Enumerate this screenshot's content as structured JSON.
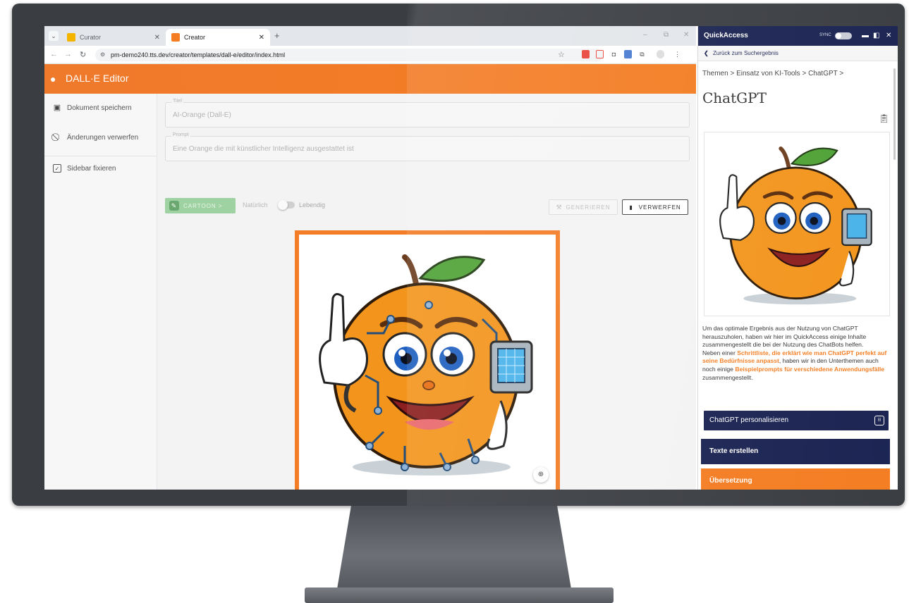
{
  "colors": {
    "accent_orange": "#f47d22",
    "navy": "#1b2452",
    "bezel": "#3a3d42",
    "cartoon_green": "#9fd2a3"
  },
  "browser": {
    "tabs": [
      {
        "label": "Curator",
        "icon": "curator-favicon"
      },
      {
        "label": "Creator",
        "icon": "creator-favicon"
      }
    ],
    "new_tab_label": "+",
    "url": "pm-demo240.tts.dev/creator/templates/dall-e/editor/index.html",
    "window_controls": [
      "–",
      "⧉",
      "✕"
    ]
  },
  "app": {
    "title": "DALL·E Editor",
    "sidebar": [
      {
        "label": "Dokument speichern",
        "icon": "save-icon"
      },
      {
        "label": "Änderungen verwerfen",
        "icon": "discard-icon"
      },
      {
        "label": "Sidebar fixieren",
        "icon": "checkbox-icon"
      }
    ],
    "title_field": {
      "label": "Titel",
      "value": "AI-Orange (Dall-E)"
    },
    "prompt_field": {
      "label": "Prompt",
      "value": "Eine Orange die mit künstlicher Intelligenz ausgestattet ist"
    },
    "style_button": "CARTOON >",
    "mode_left": "Natürlich",
    "mode_right": "Lebendig",
    "mode_value": "Natürlich",
    "generate_button": "GENERIEREN",
    "discard_button": "VERWERFEN"
  },
  "quickaccess": {
    "title": "QuickAccess",
    "sync_label": "SYNC",
    "back_link": "Zurück zum Suchergebnis",
    "breadcrumb": "Themen > Einsatz von KI-Tools > ChatGPT >",
    "heading": "ChatGPT",
    "intro_1": "Um das optimale Ergebnis aus der Nutzung von ChatGPT herauszuholen, haben wir hier im QuickAccess einige Inhalte zusammengestellt die bei der Nutzung des ChatBots helfen.",
    "intro_2_pre": "Neben einer ",
    "intro_2_link": "Schrittliste, die erklärt wie man ChatGPT perfekt auf seine Bedürfnisse anpasst",
    "intro_2_mid": ", haben wir in den Unterthemen auch noch einige ",
    "intro_2_link2": "Beispielprompts für verschiedene Anwendungsfälle",
    "intro_2_post": " zusammengestellt.",
    "items": [
      {
        "label": "ChatGPT personalisieren"
      },
      {
        "label": "Texte erstellen"
      },
      {
        "label": "Übersetzung"
      }
    ]
  }
}
